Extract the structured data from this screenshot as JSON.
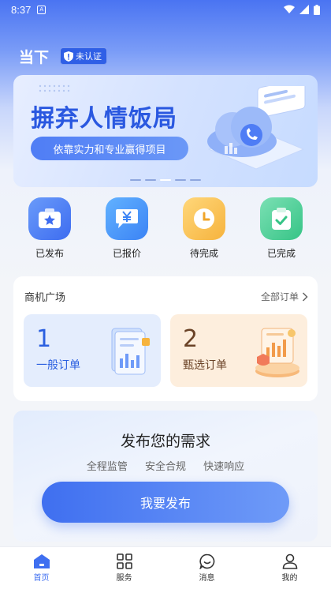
{
  "status_bar": {
    "time": "8:37",
    "indicator": "A"
  },
  "header": {
    "title": "当下",
    "badge": "未认证"
  },
  "banner": {
    "title": "摒弃人情饭局",
    "subtitle": "依靠实力和专业赢得项目",
    "active_slide": 3,
    "slide_count": 5
  },
  "quick_actions": [
    {
      "label": "已发布",
      "icon": "star-card-icon",
      "color": "#3d6cf0"
    },
    {
      "label": "已报价",
      "icon": "yen-chat-icon",
      "color": "#3b83f5"
    },
    {
      "label": "待完成",
      "icon": "clock-icon",
      "color": "#f6b33d"
    },
    {
      "label": "已完成",
      "icon": "checked-clipboard-icon",
      "color": "#36c486"
    }
  ],
  "market": {
    "title": "商机广场",
    "all_orders": "全部订单",
    "tiles": [
      {
        "number": "1",
        "label": "一般订单"
      },
      {
        "number": "2",
        "label": "甄选订单"
      }
    ]
  },
  "publish": {
    "title": "发布您的需求",
    "features": [
      "全程监管",
      "安全合规",
      "快速响应"
    ],
    "button": "我要发布"
  },
  "tabbar": {
    "items": [
      {
        "label": "首页",
        "icon": "home-icon",
        "active": true
      },
      {
        "label": "服务",
        "icon": "grid-icon",
        "active": false
      },
      {
        "label": "消息",
        "icon": "chat-icon",
        "active": false
      },
      {
        "label": "我的",
        "icon": "user-icon",
        "active": false
      }
    ]
  },
  "colors": {
    "accent": "#3f6ff0",
    "banner_title": "#2a58e0"
  }
}
